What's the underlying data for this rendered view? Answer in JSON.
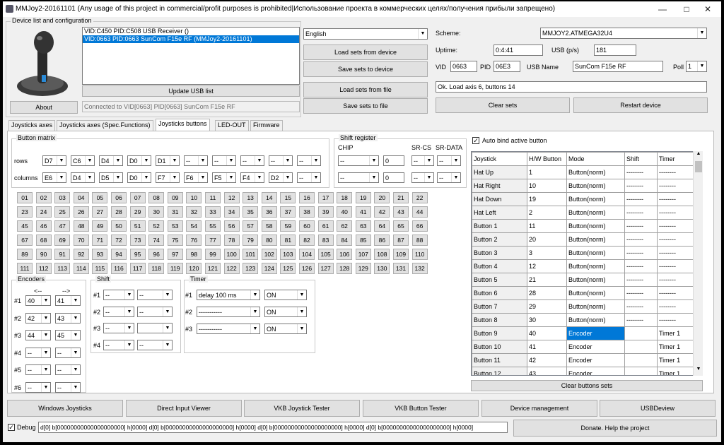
{
  "title": "MMJoy2-20161101 (Any usage of this project in commercial/profit purposes is prohibited|Использование проекта в коммерческих целях/получения прибыли запрещено)",
  "device_group": "Device list and configuration",
  "devices": [
    "VID:C450 PID:C508 USB Receiver ()",
    "VID:0663 PID:0663 SunCom F15e RF (MMJoy2-20161101)"
  ],
  "update_usb_list": "Update USB list",
  "about": "About",
  "connected_status": "Connected to VID[0663] PID[0663] SunCom F15e RF",
  "language": "English",
  "load_sets_device": "Load sets from device",
  "save_sets_device": "Save sets to device",
  "load_sets_file": "Load sets from file",
  "save_sets_file": "Save sets to file",
  "scheme_label": "Scheme:",
  "scheme_value": "MMJOY2.ATMEGA32U4",
  "uptime_label": "Uptime:",
  "uptime_value": "0:4:41",
  "usb_ps_label": "USB (p/s)",
  "usb_ps_value": "181",
  "vid_label": "VID",
  "vid_value": "0663",
  "pid_label": "PID",
  "pid_value": "06E3",
  "usb_name_label": "USB Name",
  "usb_name_value": "SunCom F15e RF",
  "poll_label": "Poll",
  "poll_value": "1",
  "status_line": "Ok. Load axis 6, buttons 14",
  "clear_sets": "Clear sets",
  "restart_device": "Restart device",
  "tabs": [
    "Joysticks axes",
    "Joysticks axes (Spec.Functions)",
    "Joysticks buttons",
    "LED-OUT",
    "Firmware"
  ],
  "active_tab": 2,
  "button_matrix_label": "Button matrix",
  "rows_label": "rows",
  "columns_label": "columns",
  "rows": [
    "D7",
    "C6",
    "D4",
    "D0",
    "D1",
    "--",
    "--",
    "--",
    "--",
    "--"
  ],
  "columns": [
    "E6",
    "D4",
    "D5",
    "D0",
    "F7",
    "F6",
    "F5",
    "F4",
    "D2",
    "--"
  ],
  "shift_register_label": "Shift register",
  "chip_label": "CHIP",
  "sr_cs_label": "SR-CS",
  "sr_data_label": "SR-DATA",
  "shift_rows": [
    {
      "chip": "--",
      "num": "0",
      "cs": "--",
      "data": "--"
    },
    {
      "chip": "--",
      "num": "0",
      "cs": "--",
      "data": "--"
    }
  ],
  "number_buttons": [
    "01",
    "02",
    "03",
    "04",
    "05",
    "06",
    "07",
    "08",
    "09",
    "10",
    "11",
    "12",
    "13",
    "14",
    "15",
    "16",
    "17",
    "18",
    "19",
    "20",
    "21",
    "22",
    "23",
    "24",
    "25",
    "26",
    "27",
    "28",
    "29",
    "30",
    "31",
    "32",
    "33",
    "34",
    "35",
    "36",
    "37",
    "38",
    "39",
    "40",
    "41",
    "42",
    "43",
    "44",
    "45",
    "46",
    "47",
    "48",
    "49",
    "50",
    "51",
    "52",
    "53",
    "54",
    "55",
    "56",
    "57",
    "58",
    "59",
    "60",
    "61",
    "62",
    "63",
    "64",
    "65",
    "66",
    "67",
    "68",
    "69",
    "70",
    "71",
    "72",
    "73",
    "74",
    "75",
    "76",
    "77",
    "78",
    "79",
    "80",
    "81",
    "82",
    "83",
    "84",
    "85",
    "86",
    "87",
    "88",
    "89",
    "90",
    "91",
    "92",
    "93",
    "94",
    "95",
    "96",
    "97",
    "98",
    "99",
    "100",
    "101",
    "102",
    "103",
    "104",
    "105",
    "106",
    "107",
    "108",
    "109",
    "110",
    "111",
    "112",
    "113",
    "114",
    "115",
    "116",
    "117",
    "118",
    "119",
    "120",
    "121",
    "122",
    "123",
    "124",
    "125",
    "126",
    "127",
    "128",
    "129",
    "130",
    "131",
    "132"
  ],
  "encoders_label": "Encoders",
  "enc_left": "<--",
  "enc_right": "-->",
  "encoders": [
    {
      "id": "#1",
      "a": "40",
      "b": "41"
    },
    {
      "id": "#2",
      "a": "42",
      "b": "43"
    },
    {
      "id": "#3",
      "a": "44",
      "b": "45"
    },
    {
      "id": "#4",
      "a": "--",
      "b": "--"
    },
    {
      "id": "#5",
      "a": "--",
      "b": "--"
    },
    {
      "id": "#6",
      "a": "--",
      "b": "--"
    }
  ],
  "shift_label": "Shift",
  "shifts": [
    {
      "id": "#1",
      "a": "--",
      "b": "--"
    },
    {
      "id": "#2",
      "a": "--",
      "b": "--"
    },
    {
      "id": "#3",
      "a": "--",
      "b": ""
    },
    {
      "id": "#4",
      "a": "--",
      "b": "--"
    }
  ],
  "timer_label": "Timer",
  "timers": [
    {
      "id": "#1",
      "delay": "delay 100 ms",
      "state": "ON"
    },
    {
      "id": "#2",
      "delay": "-----------",
      "state": "ON"
    },
    {
      "id": "#3",
      "delay": "-----------",
      "state": "ON"
    }
  ],
  "auto_bind_label": "Auto bind active button",
  "auto_bind_checked": "✓",
  "grid_headers": [
    "Joystick",
    "H/W Button",
    "Mode",
    "Shift",
    "Timer"
  ],
  "grid_rows": [
    {
      "name": "Hat Up",
      "hw": "1",
      "mode": "Button(norm)",
      "shift": "--------",
      "timer": "--------"
    },
    {
      "name": "Hat Right",
      "hw": "10",
      "mode": "Button(norm)",
      "shift": "--------",
      "timer": "--------"
    },
    {
      "name": "Hat Down",
      "hw": "19",
      "mode": "Button(norm)",
      "shift": "--------",
      "timer": "--------"
    },
    {
      "name": "Hat Left",
      "hw": "2",
      "mode": "Button(norm)",
      "shift": "--------",
      "timer": "--------"
    },
    {
      "name": "Button 1",
      "hw": "11",
      "mode": "Button(norm)",
      "shift": "--------",
      "timer": "--------"
    },
    {
      "name": "Button 2",
      "hw": "20",
      "mode": "Button(norm)",
      "shift": "--------",
      "timer": "--------"
    },
    {
      "name": "Button 3",
      "hw": "3",
      "mode": "Button(norm)",
      "shift": "--------",
      "timer": "--------"
    },
    {
      "name": "Button 4",
      "hw": "12",
      "mode": "Button(norm)",
      "shift": "--------",
      "timer": "--------"
    },
    {
      "name": "Button 5",
      "hw": "21",
      "mode": "Button(norm)",
      "shift": "--------",
      "timer": "--------"
    },
    {
      "name": "Button 6",
      "hw": "28",
      "mode": "Button(norm)",
      "shift": "--------",
      "timer": "--------"
    },
    {
      "name": "Button 7",
      "hw": "29",
      "mode": "Button(norm)",
      "shift": "--------",
      "timer": "--------"
    },
    {
      "name": "Button 8",
      "hw": "30",
      "mode": "Button(norm)",
      "shift": "--------",
      "timer": "--------"
    },
    {
      "name": "Button 9",
      "hw": "40",
      "mode": "Encoder",
      "shift": "",
      "timer": "Timer 1"
    },
    {
      "name": "Button 10",
      "hw": "41",
      "mode": "Encoder",
      "shift": "",
      "timer": "Timer 1"
    },
    {
      "name": "Button 11",
      "hw": "42",
      "mode": "Encoder",
      "shift": "",
      "timer": "Timer 1"
    },
    {
      "name": "Button 12",
      "hw": "43",
      "mode": "Encoder",
      "shift": "",
      "timer": "Timer 1"
    }
  ],
  "selected_row": 12,
  "clear_buttons_sets": "Clear buttons sets",
  "bottom_buttons": [
    "Windows Joysticks",
    "Direct Input Viewer",
    "VKB Joystick Tester",
    "VKB Button Tester",
    "Device management",
    "USBDeview"
  ],
  "debug_label": "Debug",
  "debug_checked": "✓",
  "debug_text": "d[0] b[00000000000000000000] h[0000]    d[0] b[00000000000000000000] h[0000]    d[0] b[00000000000000000000] h[0000]    d[0] b[00000000000000000000] h[0000]",
  "donate": "Donate. Help the project",
  "colors": {
    "selection": "#0078d7",
    "window": "#f0f0f0"
  }
}
